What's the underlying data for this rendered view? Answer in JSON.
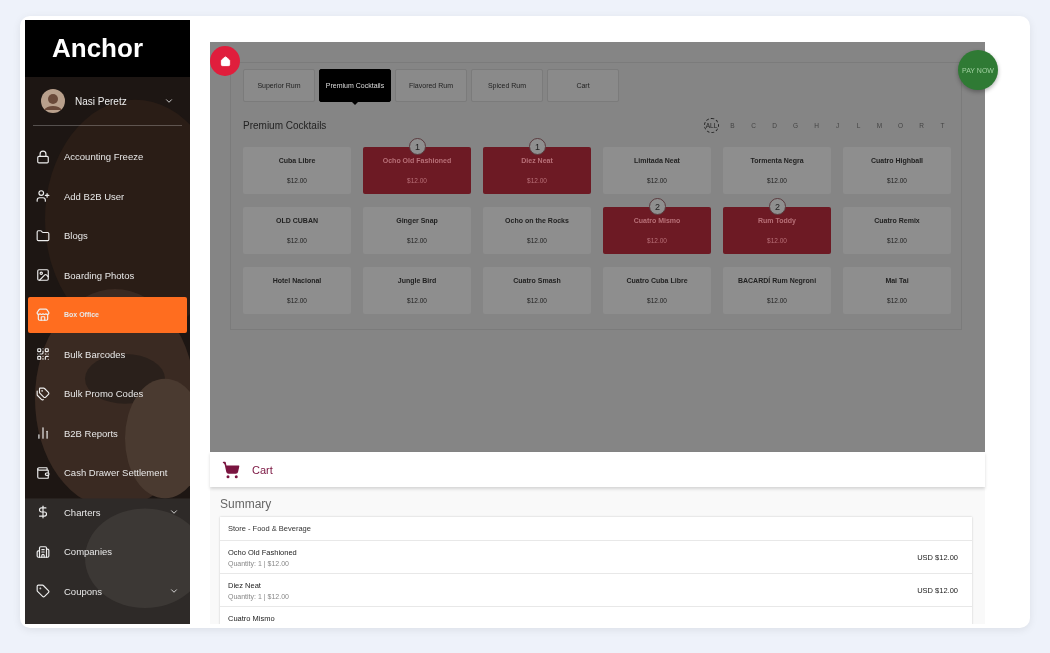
{
  "sidebar": {
    "logo": "Anchor",
    "user": {
      "name": "Nasi Peretz"
    },
    "items": [
      {
        "label": "Accounting Freeze",
        "selected": false,
        "expandable": false
      },
      {
        "label": "Add B2B User",
        "selected": false,
        "expandable": false
      },
      {
        "label": "Blogs",
        "selected": false,
        "expandable": false
      },
      {
        "label": "Boarding Photos",
        "selected": false,
        "expandable": false
      },
      {
        "label": "Box Office",
        "selected": true,
        "expandable": false
      },
      {
        "label": "Bulk Barcodes",
        "selected": false,
        "expandable": false
      },
      {
        "label": "Bulk Promo Codes",
        "selected": false,
        "expandable": false
      },
      {
        "label": "B2B Reports",
        "selected": false,
        "expandable": false
      },
      {
        "label": "Cash Drawer Settlement",
        "selected": false,
        "expandable": false
      },
      {
        "label": "Charters",
        "selected": false,
        "expandable": true
      },
      {
        "label": "Companies",
        "selected": false,
        "expandable": false
      },
      {
        "label": "Coupons",
        "selected": false,
        "expandable": true
      }
    ]
  },
  "pos": {
    "pay_button": "PAY NOW",
    "tabs": [
      {
        "label": "Superior Rum",
        "selected": false
      },
      {
        "label": "Premium Cocktails",
        "selected": true
      },
      {
        "label": "Flavored Rum",
        "selected": false
      },
      {
        "label": "Spiced Rum",
        "selected": false
      },
      {
        "label": "Cart",
        "selected": false
      }
    ],
    "heading": "Premium Cocktails",
    "letters": [
      {
        "label": "ALL",
        "selected": true
      },
      {
        "label": "B",
        "selected": false
      },
      {
        "label": "C",
        "selected": false
      },
      {
        "label": "D",
        "selected": false
      },
      {
        "label": "G",
        "selected": false
      },
      {
        "label": "H",
        "selected": false
      },
      {
        "label": "J",
        "selected": false
      },
      {
        "label": "L",
        "selected": false
      },
      {
        "label": "M",
        "selected": false
      },
      {
        "label": "O",
        "selected": false
      },
      {
        "label": "R",
        "selected": false
      },
      {
        "label": "T",
        "selected": false
      }
    ],
    "products": [
      {
        "name": "Cuba Libre",
        "price": "$12.00",
        "selected": false
      },
      {
        "name": "Ocho Old Fashioned",
        "price": "$12.00",
        "selected": true,
        "badge": "1"
      },
      {
        "name": "Diez Neat",
        "price": "$12.00",
        "selected": true,
        "badge": "1"
      },
      {
        "name": "Limitada Neat",
        "price": "$12.00",
        "selected": false
      },
      {
        "name": "Tormenta Negra",
        "price": "$12.00",
        "selected": false
      },
      {
        "name": "Cuatro Highball",
        "price": "$12.00",
        "selected": false
      },
      {
        "name": "OLD CUBAN",
        "price": "$12.00",
        "selected": false
      },
      {
        "name": "Ginger Snap",
        "price": "$12.00",
        "selected": false
      },
      {
        "name": "Ocho on the Rocks",
        "price": "$12.00",
        "selected": false
      },
      {
        "name": "Cuatro Mismo",
        "price": "$12.00",
        "selected": true,
        "badge": "2"
      },
      {
        "name": "Rum Toddy",
        "price": "$12.00",
        "selected": true,
        "badge": "2"
      },
      {
        "name": "Cuatro Remix",
        "price": "$12.00",
        "selected": false
      },
      {
        "name": "Hotel Nacional",
        "price": "$12.00",
        "selected": false
      },
      {
        "name": "Jungle Bird",
        "price": "$12.00",
        "selected": false
      },
      {
        "name": "Cuatro Smash",
        "price": "$12.00",
        "selected": false
      },
      {
        "name": "Cuatro Cuba Libre",
        "price": "$12.00",
        "selected": false
      },
      {
        "name": "BACARDÍ Rum Negroni",
        "price": "$12.00",
        "selected": false
      },
      {
        "name": "Mai Tai",
        "price": "$12.00",
        "selected": false
      }
    ]
  },
  "cart": {
    "title": "Cart",
    "summary_heading": "Summary",
    "group": "Store - Food & Beverage",
    "lines": [
      {
        "name": "Ocho Old Fashioned",
        "detail": "Quantity: 1 | $12.00",
        "total": "USD $12.00"
      },
      {
        "name": "Diez Neat",
        "detail": "Quantity: 1 | $12.00",
        "total": "USD $12.00"
      },
      {
        "name": "Cuatro Mismo"
      }
    ]
  }
}
